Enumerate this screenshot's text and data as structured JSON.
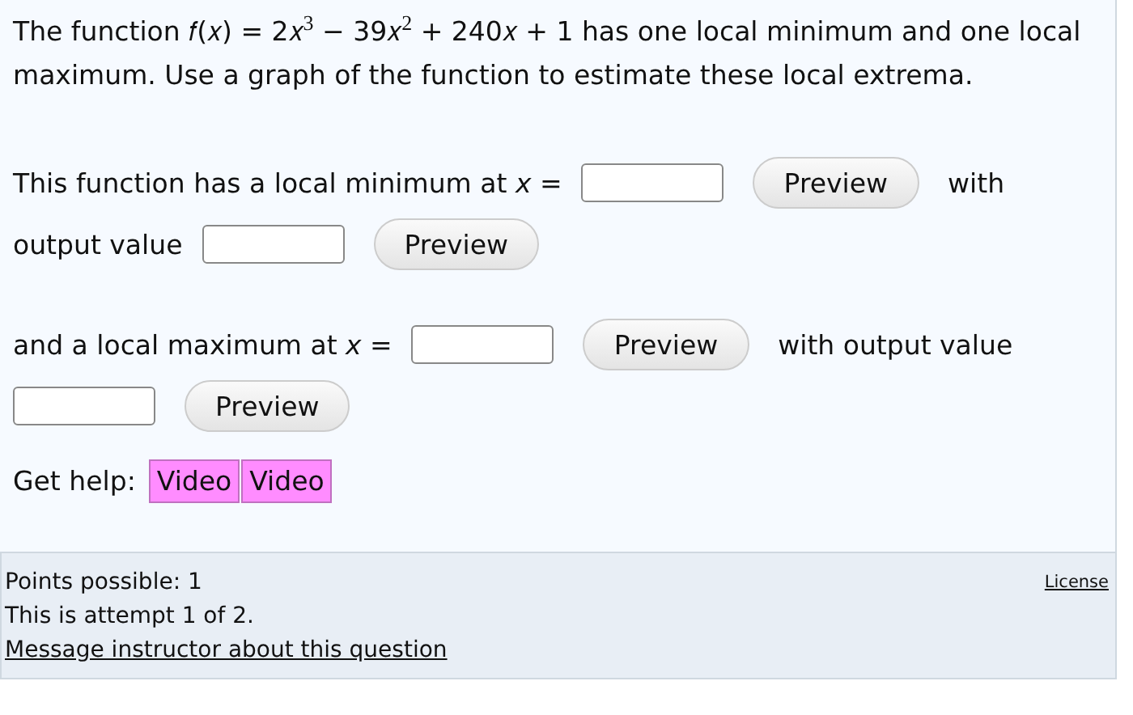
{
  "question": "The function 𝑓(𝑥) = 2𝑥$^{3}$ − 39𝑥$^{2}$ + 240𝑥 + 1 has one local minimum and one local maximum. Use a graph of the function to estimate these local extrema.",
  "answer_rows": [
    [
      {
        "kind": "text",
        "text": "This function has a local minimum at *x* ="
      },
      {
        "kind": "input"
      },
      {
        "kind": "preview",
        "label": "Preview"
      },
      {
        "kind": "text",
        "text": "with"
      }
    ],
    [
      {
        "kind": "text",
        "text": "output value"
      },
      {
        "kind": "input"
      },
      {
        "kind": "preview",
        "label": "Preview"
      }
    ],
    [
      {
        "kind": "text",
        "text": "and a local maximum at *x* ="
      },
      {
        "kind": "input"
      },
      {
        "kind": "preview",
        "label": "Preview"
      },
      {
        "kind": "text",
        "text": "with output value"
      }
    ],
    [
      {
        "kind": "input"
      },
      {
        "kind": "preview",
        "label": "Preview"
      }
    ]
  ],
  "help": {
    "label": "Get help:",
    "buttons": [
      "Video",
      "Video"
    ]
  },
  "footer": {
    "points": "Points possible: 1",
    "attempt": "This is attempt 1 of 2.",
    "message_link": "Message instructor about this question",
    "license_link": "License"
  }
}
